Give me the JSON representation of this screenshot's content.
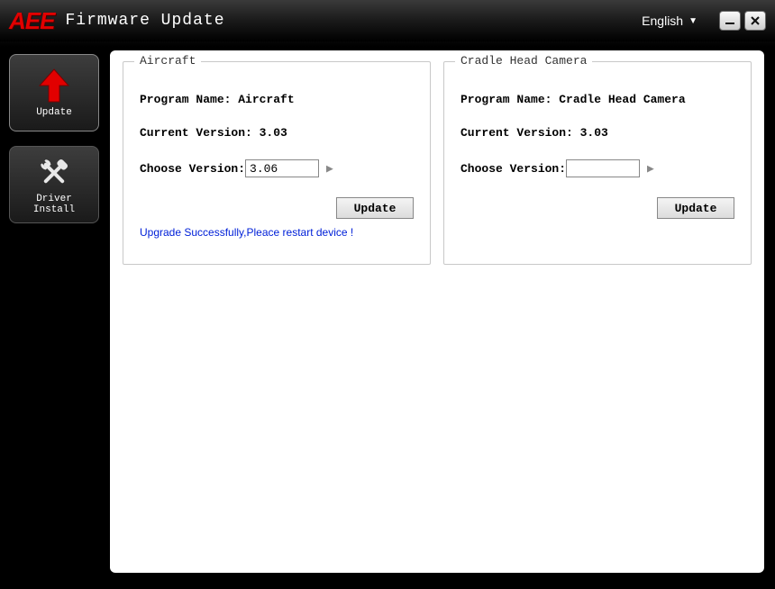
{
  "header": {
    "logo": "AEE",
    "title": "Firmware Update",
    "language": "English"
  },
  "sidebar": {
    "update_label": "Update",
    "driver_label": "Driver\nInstall"
  },
  "panels": {
    "aircraft": {
      "title": "Aircraft",
      "program_name_label": "Program Name: ",
      "program_name_value": "Aircraft",
      "current_version_label": "Current Version: ",
      "current_version_value": "3.03",
      "choose_version_label": "Choose Version:",
      "choose_version_value": "3.06",
      "update_button": "Update",
      "status": "Upgrade Successfully,Pleace restart device !"
    },
    "camera": {
      "title": "Cradle Head Camera",
      "program_name_label": "Program Name: ",
      "program_name_value": "Cradle Head Camera",
      "current_version_label": "Current Version: ",
      "current_version_value": "3.03",
      "choose_version_label": "Choose Version:",
      "choose_version_value": "",
      "update_button": "Update"
    }
  }
}
